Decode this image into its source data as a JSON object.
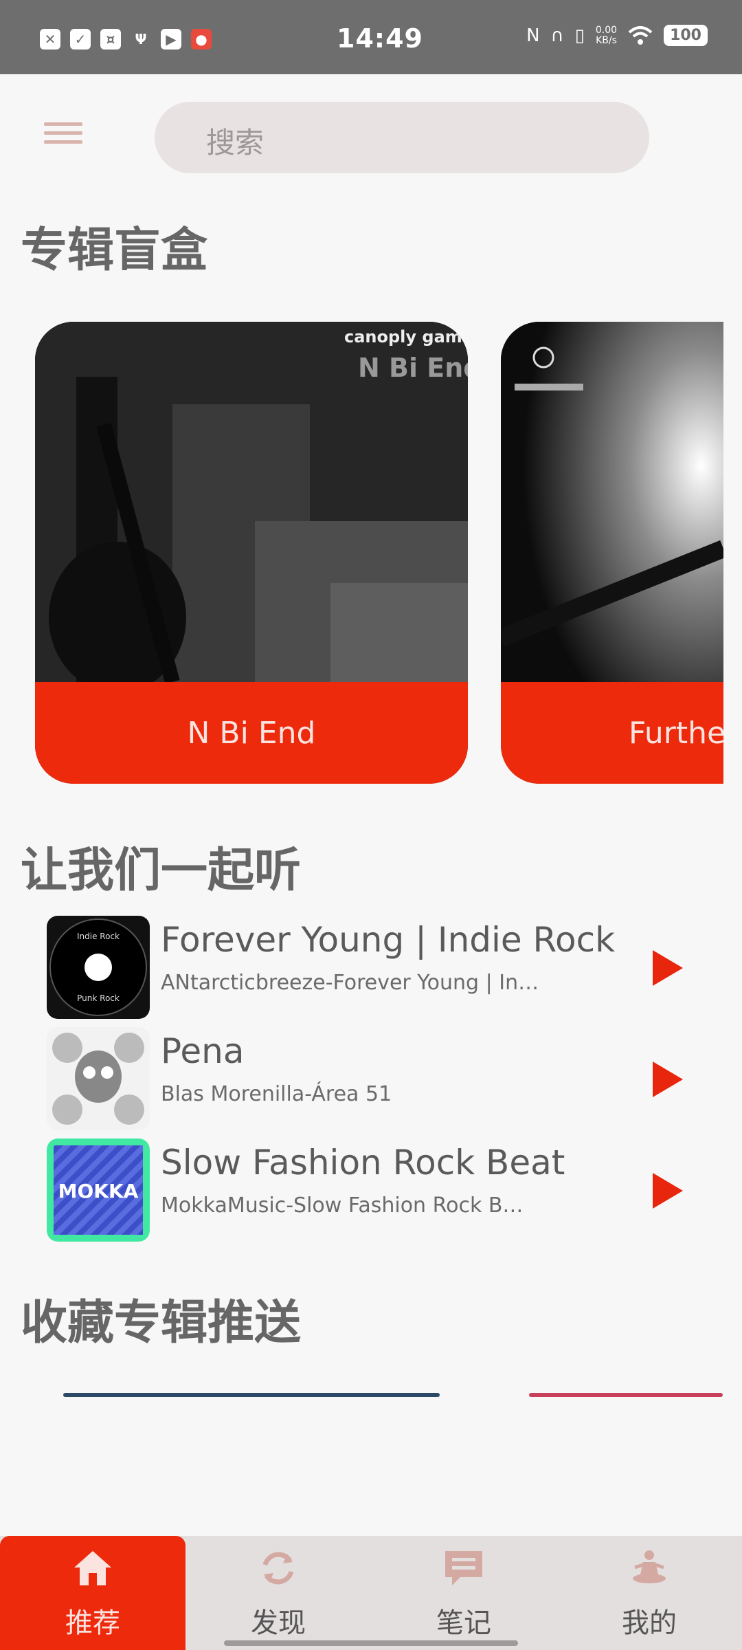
{
  "status_bar": {
    "time": "14:49",
    "net_speed_value": "0.00",
    "net_speed_unit": "KB/s",
    "battery": "100"
  },
  "search": {
    "placeholder": "搜索"
  },
  "sections": {
    "blind_box": "专辑盲盒",
    "listen_together": "让我们一起听",
    "favorites_push": "收藏专辑推送"
  },
  "albums": [
    {
      "title": "N Bi End",
      "art_text_top": "canoply game",
      "art_text_mid": "N Bi End"
    },
    {
      "title": "Furthe"
    }
  ],
  "songs": [
    {
      "title": "Forever Young | Indie Rock",
      "subtitle": "ANtarcticbreeze-Forever Young | In…",
      "cover_top": "Indie Rock",
      "cover_bottom": "Punk Rock"
    },
    {
      "title": "Pena",
      "subtitle": "Blas Morenilla-Área 51"
    },
    {
      "title": "Slow Fashion Rock Beat",
      "subtitle": "MokkaMusic-Slow Fashion Rock B…",
      "cover_text": "MOKKA"
    }
  ],
  "nav": [
    {
      "label": "推荐",
      "icon": "home-icon",
      "active": true
    },
    {
      "label": "发现",
      "icon": "refresh-icon",
      "active": false
    },
    {
      "label": "笔记",
      "icon": "message-icon",
      "active": false
    },
    {
      "label": "我的",
      "icon": "meditation-person-icon",
      "active": false
    }
  ],
  "colors": {
    "accent": "#ee2a0d",
    "background": "#f8f7f7",
    "nav_bg": "#e4dfdf"
  }
}
